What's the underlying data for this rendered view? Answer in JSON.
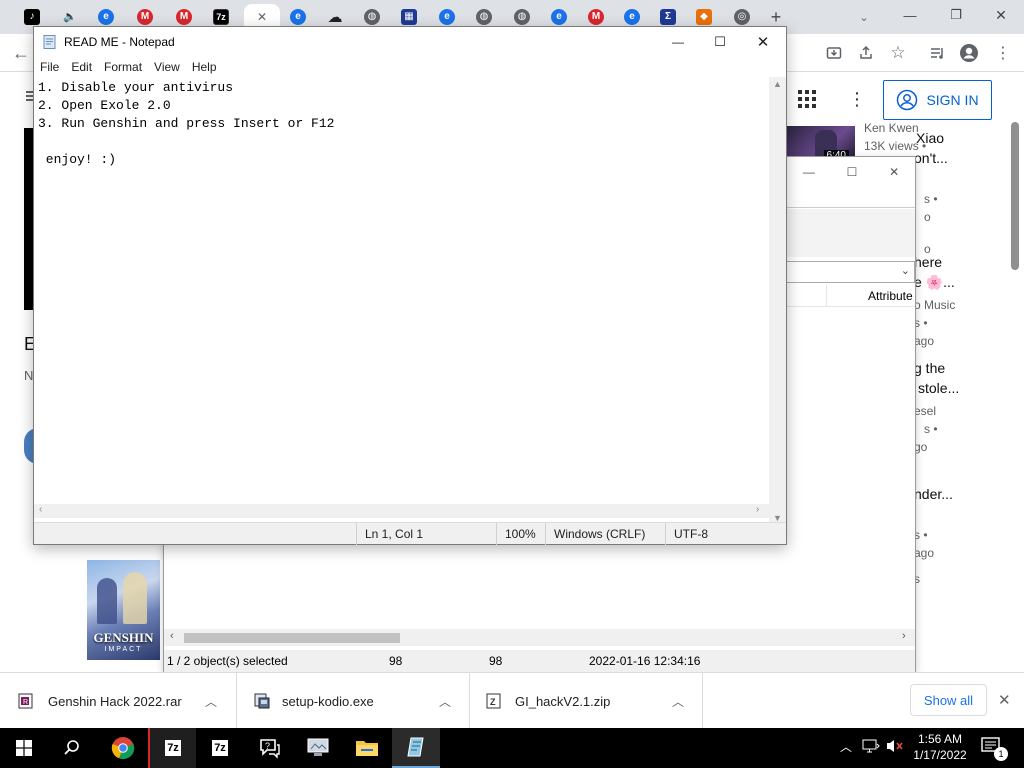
{
  "browser": {
    "new_tab_label": "+",
    "window_controls": {
      "minimize": "—",
      "restore": "❐",
      "close": "✕"
    },
    "tabs": [
      {
        "icon": "tiktok-icon",
        "color": "#000000",
        "glyph": "♪"
      },
      {
        "icon": "audio-mute-icon",
        "color": "#5f6368",
        "glyph": "🔈"
      },
      {
        "icon": "edge-like-icon",
        "color": "#1a73e8",
        "glyph": "e"
      },
      {
        "icon": "mega-icon",
        "color": "#d9272e",
        "glyph": "M"
      },
      {
        "icon": "mega-icon",
        "color": "#d9272e",
        "glyph": "M"
      },
      {
        "icon": "7zip-icon",
        "color": "#000000",
        "glyph": "7z"
      },
      {
        "icon": "close-icon",
        "color": "#5f6368",
        "glyph": "✕"
      },
      {
        "icon": "edge-like-icon",
        "color": "#1a73e8",
        "glyph": "e"
      },
      {
        "icon": "cloud-download-icon",
        "color": "#202124",
        "glyph": "☁"
      },
      {
        "icon": "globe-icon",
        "color": "#5f6368",
        "glyph": "◍"
      },
      {
        "icon": "calculator-icon",
        "color": "#1f3a93",
        "glyph": "▦"
      },
      {
        "icon": "edge-like-icon",
        "color": "#1a73e8",
        "glyph": "e"
      },
      {
        "icon": "globe-icon",
        "color": "#5f6368",
        "glyph": "◍"
      },
      {
        "icon": "globe-icon",
        "color": "#5f6368",
        "glyph": "◍"
      },
      {
        "icon": "edge-like-icon",
        "color": "#1a73e8",
        "glyph": "e"
      },
      {
        "icon": "mega-icon",
        "color": "#d9272e",
        "glyph": "M"
      },
      {
        "icon": "edge-like-icon",
        "color": "#1a73e8",
        "glyph": "e"
      },
      {
        "icon": "sigma-icon",
        "color": "#1f3a93",
        "glyph": "Σ"
      },
      {
        "icon": "diamond-icon",
        "color": "#e8710a",
        "glyph": "◆"
      },
      {
        "icon": "chrome-icon",
        "color": "#5f6368",
        "glyph": "◎"
      }
    ]
  },
  "youtube": {
    "sign_in_label": "SIGN IN",
    "left_partial": [
      "E",
      "N"
    ],
    "sidebar": {
      "channel": "Ken Kwen",
      "views": "13K views •",
      "duration": "6:40",
      "fragments": [
        {
          "text": "Xiao",
          "kind": "title"
        },
        {
          "text": "on't...",
          "kind": "title"
        },
        {
          "text": "s •",
          "kind": "meta"
        },
        {
          "text": "o",
          "kind": "meta"
        },
        {
          "text": "o",
          "kind": "meta"
        },
        {
          "text": "here",
          "kind": "title"
        },
        {
          "text": "e 🌸...",
          "kind": "title"
        },
        {
          "text": "o Music",
          "kind": "meta"
        },
        {
          "text": "s •",
          "kind": "meta"
        },
        {
          "text": "ago",
          "kind": "meta"
        },
        {
          "text": "g the",
          "kind": "title"
        },
        {
          "text": "stole...",
          "kind": "title"
        },
        {
          "text": "esel",
          "kind": "meta"
        },
        {
          "text": "s •",
          "kind": "meta"
        },
        {
          "text": "go",
          "kind": "meta"
        },
        {
          "text": "nder...",
          "kind": "title"
        },
        {
          "text": "s •",
          "kind": "meta"
        },
        {
          "text": "ago",
          "kind": "meta"
        },
        {
          "text": "s",
          "kind": "meta"
        }
      ]
    },
    "game_thumb_title": "GENSHIN",
    "game_thumb_sub": "IMPACT"
  },
  "explorer": {
    "column_header": "Attribute",
    "status": {
      "selected": "1 / 2 object(s) selected",
      "size1": "98",
      "size2": "98",
      "modified": "2022-01-16 12:34:16"
    }
  },
  "notepad": {
    "title": "READ ME - Notepad",
    "menu": [
      "File",
      "Edit",
      "Format",
      "View",
      "Help"
    ],
    "content": "1. Disable your antivirus\n2. Open Exole 2.0\n3. Run Genshin and press Insert or F12\n\n enjoy! :)",
    "status": {
      "position": "Ln 1, Col 1",
      "zoom": "100%",
      "line_ending": "Windows (CRLF)",
      "encoding": "UTF-8"
    }
  },
  "downloads": {
    "items": [
      {
        "name": "Genshin Hack 2022.rar",
        "icon": "rar-file-icon"
      },
      {
        "name": "setup-kodio.exe",
        "icon": "exe-file-icon"
      },
      {
        "name": "GI_hackV2.1.zip",
        "icon": "zip-file-icon"
      }
    ],
    "show_all_label": "Show all"
  },
  "taskbar": {
    "time": "1:56 AM",
    "date": "1/17/2022",
    "notification_count": "1"
  }
}
